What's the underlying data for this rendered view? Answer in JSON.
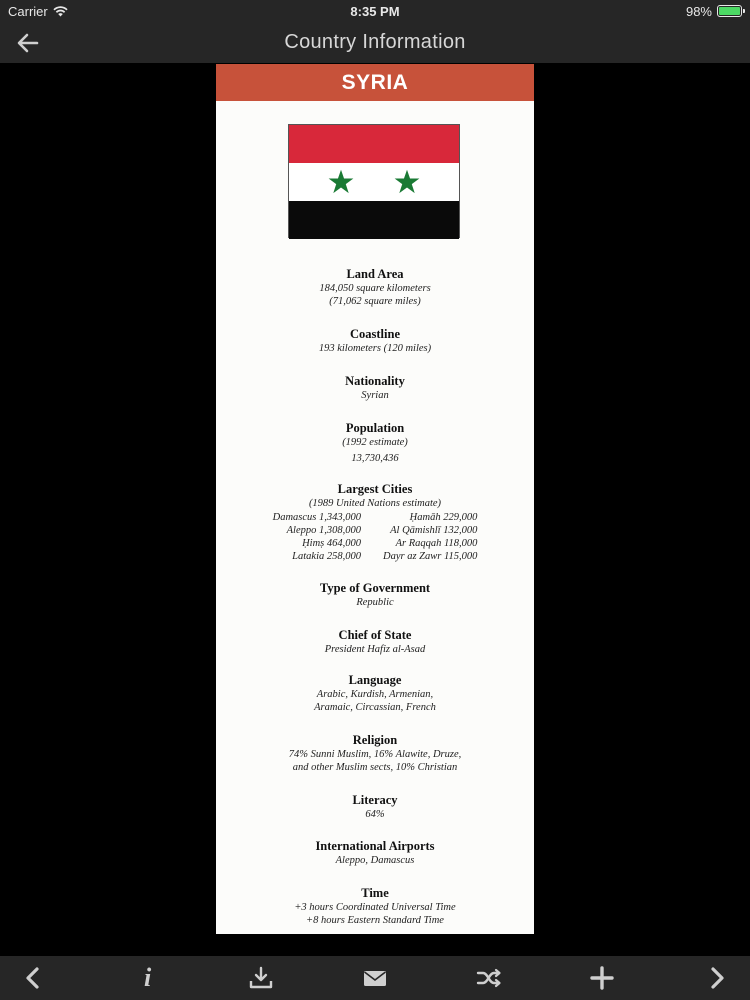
{
  "status_bar": {
    "carrier": "Carrier",
    "time": "8:35 PM",
    "battery": "98%",
    "battery_level": 0.98
  },
  "nav": {
    "title": "Country Information"
  },
  "page": {
    "country": "SYRIA",
    "colors": {
      "header": "#c7523a",
      "flag_red": "#d8283a",
      "flag_white": "#ffffff",
      "flag_black": "#0a0a0a",
      "flag_star": "#1a7a34"
    },
    "land_area": {
      "heading": "Land Area",
      "line1": "184,050 square kilometers",
      "line2": "(71,062 square miles)"
    },
    "coastline": {
      "heading": "Coastline",
      "line1": "193 kilometers (120 miles)"
    },
    "nationality": {
      "heading": "Nationality",
      "line1": "Syrian"
    },
    "population": {
      "heading": "Population",
      "line1": "(1992 estimate)",
      "line2": "13,730,436"
    },
    "largest_cities": {
      "heading": "Largest Cities",
      "note": "(1989 United Nations estimate)",
      "left": [
        "Damascus 1,343,000",
        "Aleppo 1,308,000",
        "Ḥimṣ 464,000",
        "Latakia 258,000"
      ],
      "right": [
        "Ḥamāh 229,000",
        "Al Qāmishlī 132,000",
        "Ar Raqqah 118,000",
        "Dayr az Zawr 115,000"
      ]
    },
    "government": {
      "heading": "Type of Government",
      "line1": "Republic"
    },
    "chief": {
      "heading": "Chief of State",
      "line1": "President Hafiz al-Asad"
    },
    "language": {
      "heading": "Language",
      "line1": "Arabic, Kurdish, Armenian,",
      "line2": "Aramaic, Circassian, French"
    },
    "religion": {
      "heading": "Religion",
      "line1": "74% Sunni Muslim, 16% Alawite, Druze,",
      "line2": "and other Muslim sects, 10% Christian"
    },
    "literacy": {
      "heading": "Literacy",
      "line1": "64%"
    },
    "airports": {
      "heading": "International Airports",
      "line1": "Aleppo, Damascus"
    },
    "time": {
      "heading": "Time",
      "line1": "+3 hours Coordinated Universal Time",
      "line2": "+8 hours Eastern Standard Time"
    }
  },
  "toolbar": {
    "items": [
      "chevron-left-icon",
      "info-icon",
      "download-icon",
      "mail-icon",
      "shuffle-icon",
      "plus-icon",
      "chevron-right-icon"
    ]
  }
}
